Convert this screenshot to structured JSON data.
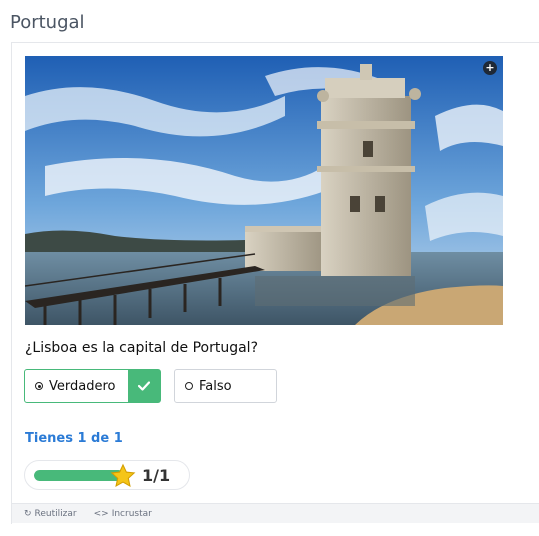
{
  "page": {
    "title": "Portugal"
  },
  "image": {
    "alt": "Torre de Belém",
    "expand_icon": "plus-icon"
  },
  "question": {
    "text": "¿Lisboa es la capital de Portugal?",
    "options": [
      {
        "label": "Verdadero",
        "selected": true,
        "state": "correct"
      },
      {
        "label": "Falso",
        "selected": false,
        "state": "neutral"
      }
    ]
  },
  "result": {
    "attempts_text": "Tienes 1 de 1",
    "score_text": "1/1",
    "progress": 1.0
  },
  "footer": {
    "reuse_label": "Reutilizar",
    "embed_label": "Incrustar"
  },
  "colors": {
    "accent_green": "#48b97a",
    "link_blue": "#2b7bd6",
    "star_yellow": "#f5c518"
  }
}
